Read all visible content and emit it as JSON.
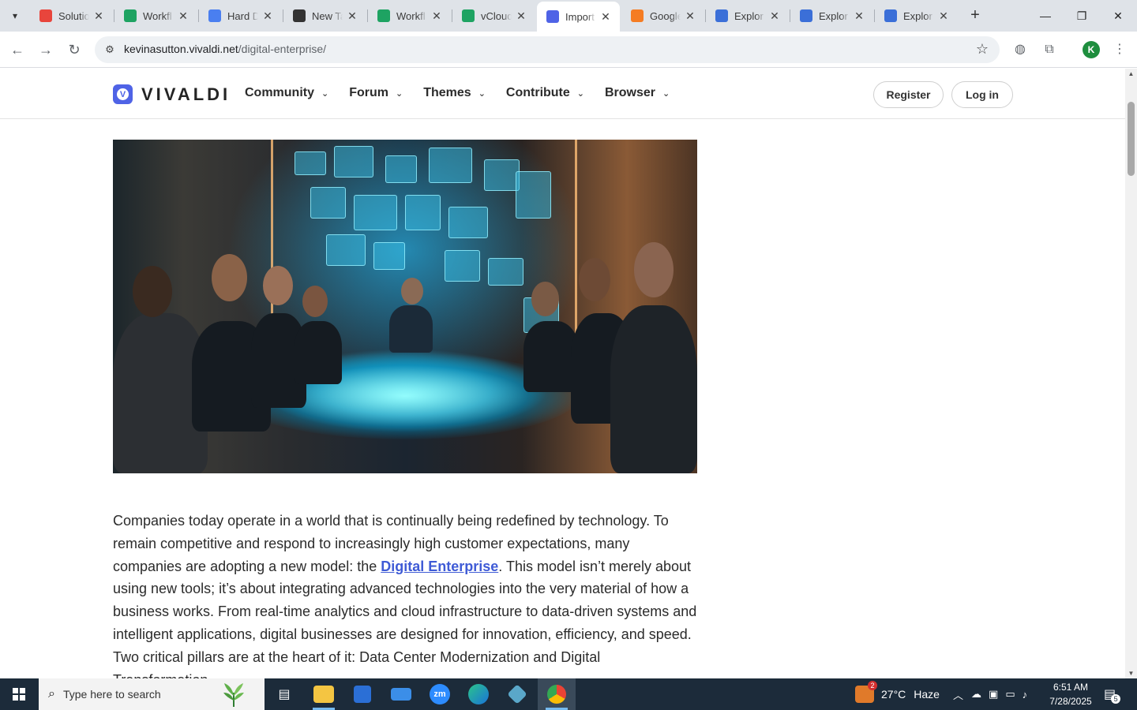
{
  "browser": {
    "tabs": [
      {
        "title": "Solutio",
        "favicon": "gem-icon",
        "color": "#e8453c",
        "active": false
      },
      {
        "title": "Workfl",
        "favicon": "sheets-icon",
        "color": "#1ea362",
        "active": false
      },
      {
        "title": "Hard D",
        "favicon": "docs-icon",
        "color": "#4a7ff0",
        "active": false
      },
      {
        "title": "New Ta",
        "favicon": "github-icon",
        "color": "#333333",
        "active": false
      },
      {
        "title": "Workfl",
        "favicon": "sheets-icon",
        "color": "#1ea362",
        "active": false
      },
      {
        "title": "vCloud",
        "favicon": "sheets-icon",
        "color": "#1ea362",
        "active": false
      },
      {
        "title": "Import",
        "favicon": "vivaldi-icon",
        "color": "#4f63e6",
        "active": true
      },
      {
        "title": "Google",
        "favicon": "firebase-icon",
        "color": "#f57c23",
        "active": false
      },
      {
        "title": "Explor",
        "favicon": "gemini-icon",
        "color": "#3b6fd8",
        "active": false
      },
      {
        "title": "Explor",
        "favicon": "gemini-icon",
        "color": "#3b6fd8",
        "active": false
      },
      {
        "title": "Explor",
        "favicon": "gemini-icon",
        "color": "#3b6fd8",
        "active": false
      }
    ],
    "url_host": "kevinasutton.vivaldi.net",
    "url_path": "/digital-enterprise/",
    "profile_initial": "K"
  },
  "site": {
    "logo_text": "VIVALDI",
    "nav": [
      "Community",
      "Forum",
      "Themes",
      "Contribute",
      "Browser"
    ],
    "register_label": "Register",
    "login_label": "Log in"
  },
  "article": {
    "p1_before": "Companies today operate in a world that is continually being redefined by technology. To remain competitive and respond to increasingly high customer expectations, many companies are adopting a new model: the ",
    "p1_link": "Digital Enterprise",
    "p1_after": ". This model isn’t merely about using new tools; it’s about integrating advanced technologies into the very material of how a business works. From real-time analytics and cloud infrastructure to data-driven systems and intelligent applications, digital businesses are designed for innovation, efficiency, and speed. Two critical pillars are at the heart of it: Data Center Modernization and Digital Transformation."
  },
  "taskbar": {
    "search_placeholder": "Type here to search",
    "weather_temp": "27°C",
    "weather_desc": "Haze",
    "weather_badge": "2",
    "time": "6:51 AM",
    "date": "7/28/2025",
    "notification_count": "5"
  }
}
